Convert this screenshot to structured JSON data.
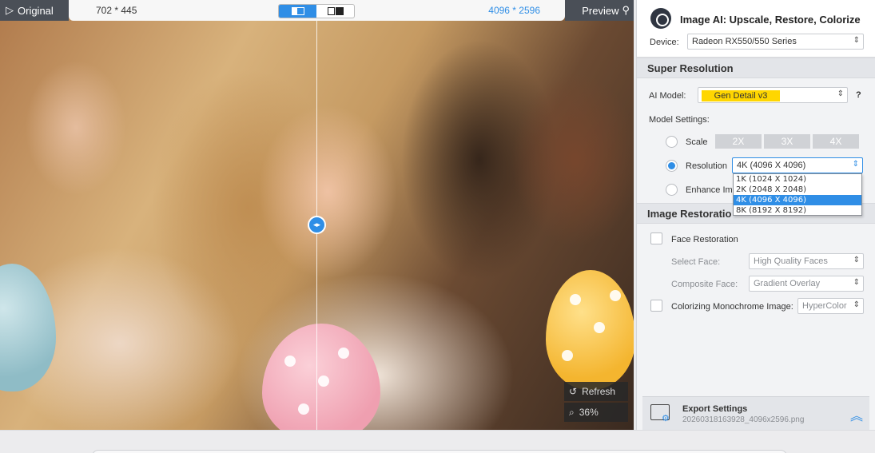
{
  "preview": {
    "original_label": "Original",
    "preview_label": "Preview",
    "original_dims": "702 * 445",
    "output_dims": "4096 * 2596",
    "refresh_label": "Refresh",
    "zoom": "36%"
  },
  "panel": {
    "app_title": "Image AI: Upscale, Restore, Colorize",
    "device_label": "Device:",
    "device_value": "Radeon RX550/550 Series",
    "super_resolution": {
      "title": "Super Resolution",
      "ai_model_label": "AI Model:",
      "ai_model_value": "Gen Detail v3",
      "help": "?",
      "model_settings_label": "Model Settings:",
      "scale_label": "Scale",
      "scale_options": [
        "2X",
        "3X",
        "4X"
      ],
      "resolution_label": "Resolution",
      "resolution_value": "4K (4096 X 4096)",
      "resolution_options": [
        "1K (1024 X 1024)",
        "2K (2048 X 2048)",
        "4K (4096 X 4096)",
        "8K (8192 X 8192)"
      ],
      "enhance_label": "Enhance Ima"
    },
    "image_restoration": {
      "title": "Image Restoratio",
      "face_restoration_label": "Face Restoration",
      "select_face_label": "Select Face:",
      "select_face_value": "High Quality Faces",
      "composite_face_label": "Composite Face:",
      "composite_face_value": "Gradient Overlay",
      "colorize_label": "Colorizing Monochrome Image:",
      "colorize_value": "HyperColor"
    },
    "export": {
      "title": "Export Settings",
      "filename": "20260318163928_4096x2596.png"
    }
  },
  "colors": {
    "accent": "#2f8ee6",
    "highlight": "#ffd600",
    "topbar_dark": "#4a4f57"
  }
}
